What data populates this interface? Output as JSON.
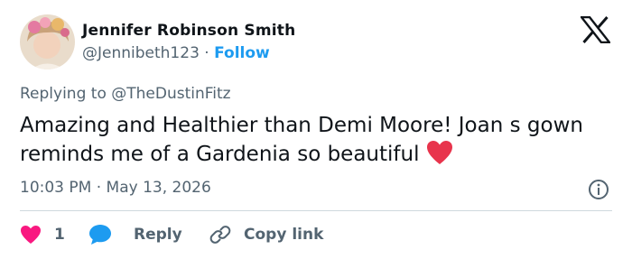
{
  "author": {
    "name": "Jennifer Robinson Smith",
    "handle": "@Jennibeth123",
    "separator": "·",
    "follow_label": "Follow"
  },
  "reply_to": {
    "prefix": "Replying to",
    "handle": "@TheDustinFitz"
  },
  "tweet": {
    "text": "Amazing and Healthier than Demi Moore! Joan s gown reminds me of a Gardenia so beautiful"
  },
  "meta": {
    "time": "10:03 PM",
    "separator": "·",
    "date": "May 13, 2026"
  },
  "actions": {
    "like_count": "1",
    "reply_label": "Reply",
    "copy_label": "Copy link"
  },
  "colors": {
    "accent": "#1d9bf0",
    "like": "#f91880",
    "muted": "#536471",
    "text": "#0f1419",
    "heart_emoji": "#e8344c"
  }
}
